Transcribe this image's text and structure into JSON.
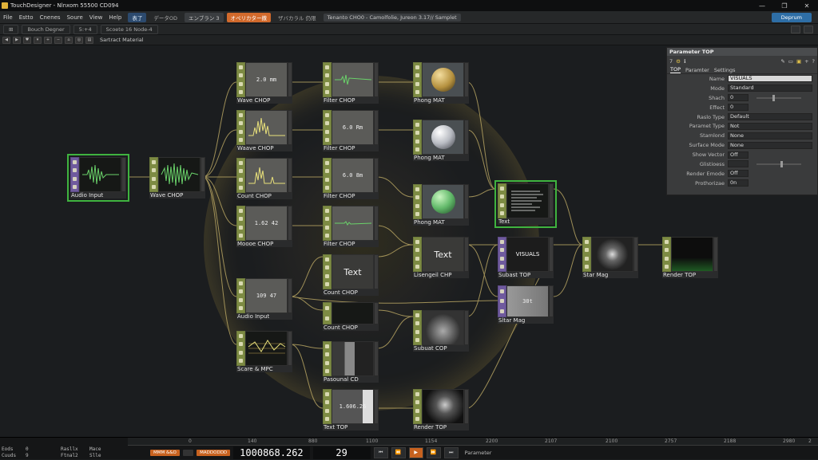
{
  "window": {
    "title": "TouchDesigner - Nlnxom 55500 CD094"
  },
  "menu": {
    "items": [
      "File",
      "Estto",
      "Cnenes",
      "Soure",
      "View",
      "Help"
    ],
    "chip1": "表了",
    "chip2": "データOD",
    "chip3": "エンブラン 3",
    "chip4": "オペリカター撒",
    "chip5": "ザバカラル 仍限",
    "project": "Tenanto CHO0 - Camolfolie, Jureon 3.17// Samplet",
    "deploy": "Deprum"
  },
  "toolbar": {
    "left": "Bouch Degner",
    "mid1": "5:+4",
    "mid2": "Scoete 16 Node-4"
  },
  "pathbar": {
    "path": "Sartract Material"
  },
  "nodes": {
    "audio_in": {
      "label": "Audio Input"
    },
    "wave_main": {
      "label": "Wave CHOP"
    },
    "wave1": {
      "label": "Wave CHOP",
      "value": "2.0 mm"
    },
    "wave2": {
      "label": "Waave CHOP"
    },
    "count1": {
      "label": "Count CHOP"
    },
    "moose": {
      "label": "Moooe CHOP",
      "value": "1.62 42"
    },
    "audio_in2": {
      "label": "Audio Input",
      "value": "109 47"
    },
    "scare": {
      "label": "Scare & MPC"
    },
    "filter1": {
      "label": "Filter CHOP"
    },
    "filter2": {
      "label": "Filter CHOP",
      "value": "6.0 Rm"
    },
    "filter3": {
      "label": "Filter CHOP",
      "value": "6.0 8m"
    },
    "filter4": {
      "label": "Filter CHOP"
    },
    "count2": {
      "label": "Count CHOP",
      "value": "Text"
    },
    "count3": {
      "label": "Count CHOP"
    },
    "pasounal": {
      "label": "Pasounal CD"
    },
    "text_top": {
      "label": "Text TOP",
      "value": "1.606.26"
    },
    "phong1": {
      "label": "Phong MAT"
    },
    "phong2": {
      "label": "Phong MAT"
    },
    "phong3": {
      "label": "Phong MAT"
    },
    "lisengeil": {
      "label": "Lisengeil CHP",
      "value": "Text"
    },
    "subuat": {
      "label": "Subuat COP"
    },
    "render_top1": {
      "label": "Render TOP"
    },
    "text_sel": {
      "label": "Text"
    },
    "subast": {
      "label": "Subast TOP",
      "value": "VISUALS"
    },
    "star_mag2": {
      "label": "Sltar Mag",
      "value": "30t"
    },
    "star_mag": {
      "label": "Star Mag"
    },
    "render_top2": {
      "label": "Render TOP"
    }
  },
  "params": {
    "header": "Parameter TOP",
    "count": "7",
    "tabs": [
      "TOP",
      "Paramter",
      "Settings"
    ],
    "rows": [
      {
        "label": "Name",
        "value": "VISUALS"
      },
      {
        "label": "Mode",
        "value": "Standard"
      },
      {
        "label": "Shach",
        "value": "0"
      },
      {
        "label": "Effect",
        "value": "0"
      },
      {
        "label": "Raslo Type",
        "value": "Default"
      },
      {
        "label": "Paramet Type",
        "value": "Not"
      },
      {
        "label": "Stamlond",
        "value": "None"
      },
      {
        "label": "Surface Mode",
        "value": "None"
      },
      {
        "label": "Show Vector",
        "value": "Off"
      },
      {
        "label": "Glistioess",
        "value": ""
      },
      {
        "label": "Render Emode",
        "value": "Off"
      },
      {
        "label": "Prothorizae",
        "value": "0n"
      }
    ]
  },
  "timeline": {
    "left": [
      "Eods",
      "0",
      "Rasllx",
      "Mace",
      "Cuuds",
      "9",
      "Ftnal2",
      "Slle"
    ],
    "ruler": [
      "0",
      "140",
      "880",
      "1100",
      "1154",
      "2200",
      "2107",
      "2100",
      "2757",
      "2188",
      "2980",
      "2"
    ],
    "pill1": "MMM &&O",
    "pill2": "MADDODDD",
    "counter": "1000868.262",
    "frame": "29",
    "panel": "Parameter"
  }
}
